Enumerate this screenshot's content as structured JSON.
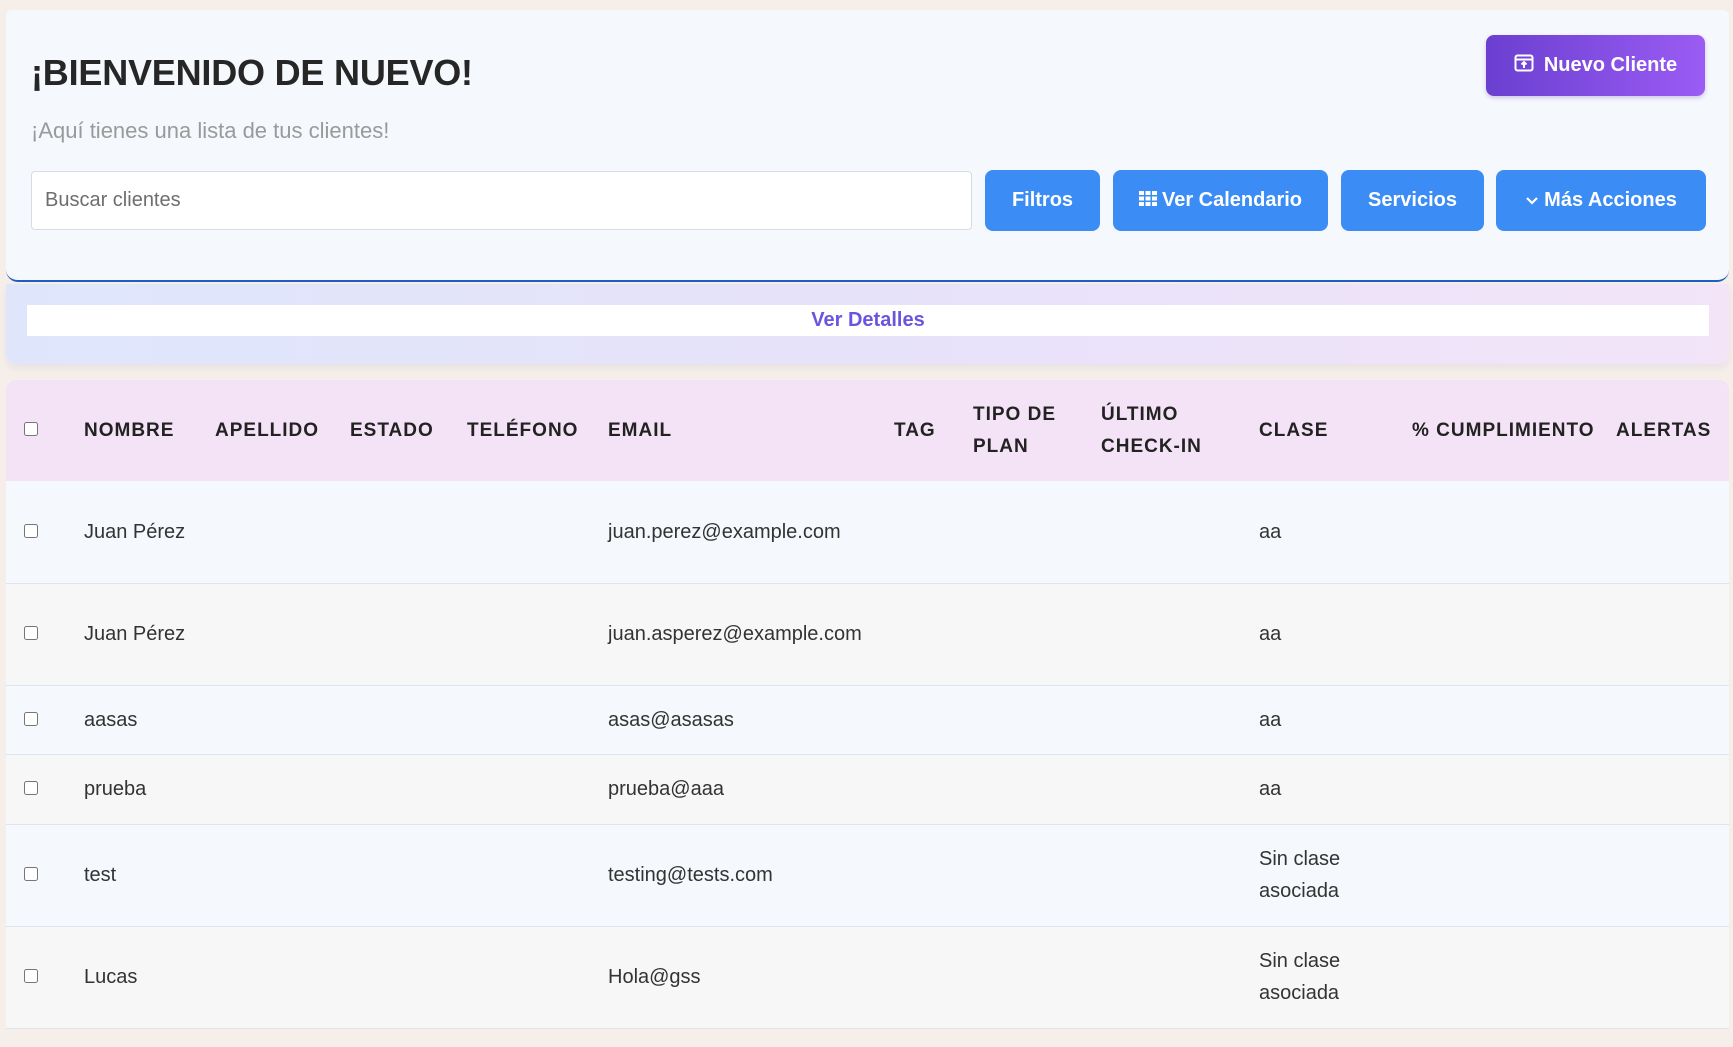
{
  "header": {
    "title": "¡BIENVENIDO DE NUEVO!",
    "subtitle": "¡Aquí tienes una lista de tus clientes!",
    "new_client_label": "Nuevo Cliente"
  },
  "toolbar": {
    "search_placeholder": "Buscar clientes",
    "search_value": "",
    "filters_label": "Filtros",
    "calendar_label": "Ver Calendario",
    "services_label": "Servicios",
    "more_actions_label": "Más Acciones"
  },
  "details": {
    "label": "Ver Detalles"
  },
  "table": {
    "columns": [
      "NOMBRE",
      "APELLIDO",
      "ESTADO",
      "TELÉFONO",
      "EMAIL",
      "TAG",
      "TIPO DE PLAN",
      "ÚLTIMO CHECK-IN",
      "CLASE",
      "% CUMPLIMIENTO",
      "ALERTAS"
    ],
    "rows": [
      {
        "nombre": "Juan Pérez",
        "apellido": "",
        "estado": "",
        "telefono": "",
        "email": "juan.perez@example.com",
        "tag": "",
        "plan": "",
        "checkin": "",
        "clase": "aa",
        "cumplimiento": "",
        "alertas": ""
      },
      {
        "nombre": "Juan Pérez",
        "apellido": "",
        "estado": "",
        "telefono": "",
        "email": "juan.asperez@example.com",
        "tag": "",
        "plan": "",
        "checkin": "",
        "clase": "aa",
        "cumplimiento": "",
        "alertas": ""
      },
      {
        "nombre": "aasas",
        "apellido": "",
        "estado": "",
        "telefono": "",
        "email": "asas@asasas",
        "tag": "",
        "plan": "",
        "checkin": "",
        "clase": "aa",
        "cumplimiento": "",
        "alertas": ""
      },
      {
        "nombre": "prueba",
        "apellido": "",
        "estado": "",
        "telefono": "",
        "email": "prueba@aaa",
        "tag": "",
        "plan": "",
        "checkin": "",
        "clase": "aa",
        "cumplimiento": "",
        "alertas": ""
      },
      {
        "nombre": "test",
        "apellido": "",
        "estado": "",
        "telefono": "",
        "email": "testing@tests.com",
        "tag": "",
        "plan": "",
        "checkin": "",
        "clase": "Sin clase asociada",
        "cumplimiento": "",
        "alertas": ""
      },
      {
        "nombre": "Lucas",
        "apellido": "",
        "estado": "",
        "telefono": "",
        "email": "Hola@gss",
        "tag": "",
        "plan": "",
        "checkin": "",
        "clase": "Sin clase asociada",
        "cumplimiento": "",
        "alertas": ""
      }
    ]
  },
  "colors": {
    "primary_button": "#3b8cf5",
    "accent_gradient_start": "#6a3fd0",
    "accent_gradient_end": "#9b5cf4",
    "table_header_bg": "#f4e2f6",
    "details_text": "#6a55e0"
  },
  "icons": {
    "new_client": "window-plus-icon",
    "calendar": "grid-icon",
    "more_actions": "chevron-down-icon"
  }
}
